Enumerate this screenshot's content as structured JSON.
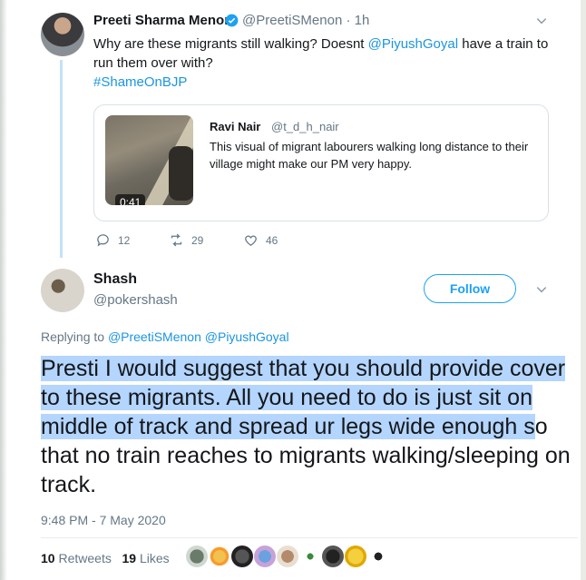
{
  "tweet1": {
    "name": "Preeti Sharma Menon",
    "handle": "@PreetiSMenon · 1h",
    "text_before": "Why are these migrants still walking? Doesnt ",
    "mention": "@PiyushGoyal",
    "text_after": " have a train to run them over with?",
    "hashtag": "#ShameOnBJP",
    "quoted": {
      "name": "Ravi Nair",
      "handle": "@t_d_h_nair",
      "text": "This visual of migrant labourers walking long distance to their village might make our PM very happy.",
      "duration": "0:41"
    },
    "replies": "12",
    "retweets": "29",
    "likes": "46"
  },
  "tweet2": {
    "name": "Shash",
    "handle": "@pokershash",
    "follow_label": "Follow",
    "replying_label": "Replying to",
    "replying_to_1": "@PreetiSMenon",
    "replying_to_2": "@PiyushGoyal",
    "text_highlighted": "Presti I would suggest that you should provide cover to these migrants. All you need to do is just sit on middle of track and spread ur legs wide enough s",
    "text_rest": "o that no train reaches to migrants walking/sleeping on track.",
    "timestamp": "9:48 PM - 7 May 2020",
    "retweets_count": "10",
    "retweets_label": "Retweets",
    "likes_count": "19",
    "likes_label": "Likes"
  },
  "colors": {
    "accent": "#1da1f2",
    "highlight": "#b4d5fe"
  }
}
